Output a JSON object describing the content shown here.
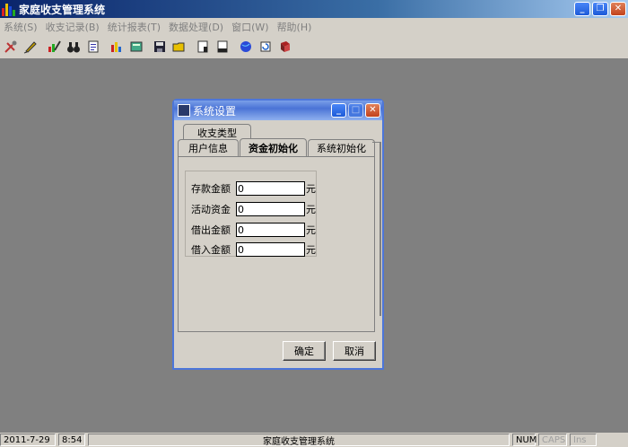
{
  "app": {
    "title": "家庭收支管理系统",
    "colors": {
      "titlebar": "#0a246a",
      "desktop": "#808080",
      "dialog_frame": "#4d76d9"
    }
  },
  "menu": [
    {
      "label": "系统(S)",
      "enabled": false
    },
    {
      "label": "收支记录(B)",
      "enabled": false
    },
    {
      "label": "统计报表(T)",
      "enabled": false
    },
    {
      "label": "数据处理(D)",
      "enabled": false
    },
    {
      "label": "窗口(W)",
      "enabled": false
    },
    {
      "label": "帮助(H)",
      "enabled": false
    }
  ],
  "toolbar": {
    "icons": [
      "tools-icon",
      "pen-icon",
      "chart-edit-icon",
      "binoculars-icon",
      "report-icon",
      "bar-chart-icon",
      "calculator-icon",
      "save-icon",
      "open-folder-icon",
      "document-icon",
      "document-alt-icon",
      "globe-icon",
      "refresh-icon",
      "book-icon"
    ]
  },
  "dialog": {
    "title": "系统设置",
    "tabs": {
      "income_type": "收支类型",
      "user_info": "用户信息",
      "fund_init": "资金初始化",
      "system_init": "系统初始化"
    },
    "active_tab": "资金初始化",
    "fields": [
      {
        "label": "存款金额",
        "value": "0",
        "unit": "元"
      },
      {
        "label": "活动资金",
        "value": "0",
        "unit": "元"
      },
      {
        "label": "借出金额",
        "value": "0",
        "unit": "元"
      },
      {
        "label": "借入金额",
        "value": "0",
        "unit": "元"
      }
    ],
    "ok_label": "确定",
    "cancel_label": "取消"
  },
  "status": {
    "date": "2011-7-29",
    "time": "8:54",
    "app_name": "家庭收支管理系统",
    "num": "NUM",
    "caps": "CAPS",
    "ins": "Ins"
  }
}
